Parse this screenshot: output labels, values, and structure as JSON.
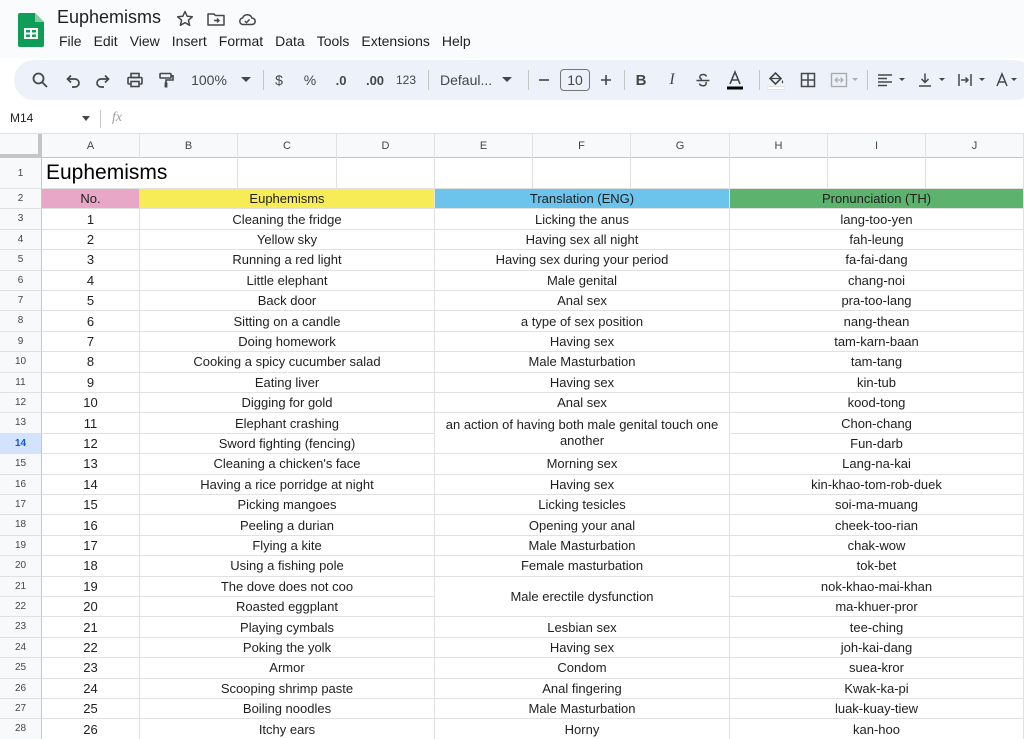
{
  "doc": {
    "title": "Euphemisms"
  },
  "menu": [
    "File",
    "Edit",
    "View",
    "Insert",
    "Format",
    "Data",
    "Tools",
    "Extensions",
    "Help"
  ],
  "toolbar": {
    "zoom": "100%",
    "currency": "$",
    "percent": "%",
    "decrease_decimal": ".0",
    "increase_decimal": ".00",
    "number_format": "123",
    "font": "Defaul...",
    "font_size": "10"
  },
  "formula_bar": {
    "name_box": "M14",
    "fx": "fx"
  },
  "columns": [
    "A",
    "B",
    "C",
    "D",
    "E",
    "F",
    "G",
    "H",
    "I",
    "J"
  ],
  "sheet": {
    "title": "Euphemisms",
    "headers": {
      "no": "No.",
      "euphemism": "Euphemisms",
      "translation": "Translation (ENG)",
      "pronunciation": "Pronunciation (TH)"
    },
    "header_colors": {
      "no": "#e8a7c7",
      "euphemism": "#f7ec56",
      "translation": "#6cc4ed",
      "pronunciation": "#5db36e"
    }
  },
  "row_numbers": [
    "1",
    "2",
    "3",
    "4",
    "5",
    "6",
    "7",
    "8",
    "9",
    "10",
    "11",
    "12",
    "13",
    "14",
    "15",
    "16",
    "17",
    "18",
    "19",
    "20",
    "21",
    "22",
    "23",
    "24",
    "25",
    "26",
    "27",
    "28"
  ],
  "active_row": "14",
  "rows": [
    {
      "no": "1",
      "euphemism": "Cleaning the fridge",
      "translation": "Licking the anus",
      "pronunciation": "lang-too-yen"
    },
    {
      "no": "2",
      "euphemism": "Yellow sky",
      "translation": "Having sex all night",
      "pronunciation": "fah-leung"
    },
    {
      "no": "3",
      "euphemism": "Running a red light",
      "translation": "Having sex during your period",
      "pronunciation": "fa-fai-dang"
    },
    {
      "no": "4",
      "euphemism": "Little elephant",
      "translation": "Male genital",
      "pronunciation": "chang-noi"
    },
    {
      "no": "5",
      "euphemism": "Back door",
      "translation": "Anal sex",
      "pronunciation": "pra-too-lang"
    },
    {
      "no": "6",
      "euphemism": "Sitting on a candle",
      "translation": "a type of sex position",
      "pronunciation": "nang-thean"
    },
    {
      "no": "7",
      "euphemism": "Doing homework",
      "translation": "Having sex",
      "pronunciation": "tam-karn-baan"
    },
    {
      "no": "8",
      "euphemism": "Cooking a spicy cucumber salad",
      "translation": "Male Masturbation",
      "pronunciation": "tam-tang"
    },
    {
      "no": "9",
      "euphemism": "Eating liver",
      "translation": "Having sex",
      "pronunciation": "kin-tub"
    },
    {
      "no": "10",
      "euphemism": "Digging for gold",
      "translation": "Anal sex",
      "pronunciation": "kood-tong"
    },
    {
      "no": "11",
      "euphemism": "Elephant crashing",
      "translation": "an action of having both male genital touch one another",
      "pronunciation": "Chon-chang"
    },
    {
      "no": "12",
      "euphemism": "Sword fighting (fencing)",
      "translation": "",
      "pronunciation": "Fun-darb"
    },
    {
      "no": "13",
      "euphemism": "Cleaning a chicken's face",
      "translation": "Morning sex",
      "pronunciation": "Lang-na-kai"
    },
    {
      "no": "14",
      "euphemism": "Having a rice porridge at night",
      "translation": "Having sex",
      "pronunciation": "kin-khao-tom-rob-duek"
    },
    {
      "no": "15",
      "euphemism": "Picking mangoes",
      "translation": "Licking tesicles",
      "pronunciation": "soi-ma-muang"
    },
    {
      "no": "16",
      "euphemism": "Peeling a durian",
      "translation": "Opening your anal",
      "pronunciation": "cheek-too-rian"
    },
    {
      "no": "17",
      "euphemism": "Flying a kite",
      "translation": "Male Masturbation",
      "pronunciation": "chak-wow"
    },
    {
      "no": "18",
      "euphemism": "Using a fishing pole",
      "translation": "Female masturbation",
      "pronunciation": "tok-bet"
    },
    {
      "no": "19",
      "euphemism": "The dove does not coo",
      "translation": "Male erectile dysfunction",
      "pronunciation": "nok-khao-mai-khan"
    },
    {
      "no": "20",
      "euphemism": "Roasted eggplant",
      "translation": "",
      "pronunciation": "ma-khuer-pror"
    },
    {
      "no": "21",
      "euphemism": "Playing cymbals",
      "translation": "Lesbian sex",
      "pronunciation": "tee-ching"
    },
    {
      "no": "22",
      "euphemism": "Poking the yolk",
      "translation": "Having sex",
      "pronunciation": "joh-kai-dang"
    },
    {
      "no": "23",
      "euphemism": "Armor",
      "translation": "Condom",
      "pronunciation": "suea-kror"
    },
    {
      "no": "24",
      "euphemism": "Scooping shrimp paste",
      "translation": "Anal fingering",
      "pronunciation": "Kwak-ka-pi"
    },
    {
      "no": "25",
      "euphemism": "Boiling noodles",
      "translation": "Male Masturbation",
      "pronunciation": "luak-kuay-tiew"
    },
    {
      "no": "26",
      "euphemism": "Itchy ears",
      "translation": "Horny",
      "pronunciation": "kan-hoo"
    }
  ]
}
